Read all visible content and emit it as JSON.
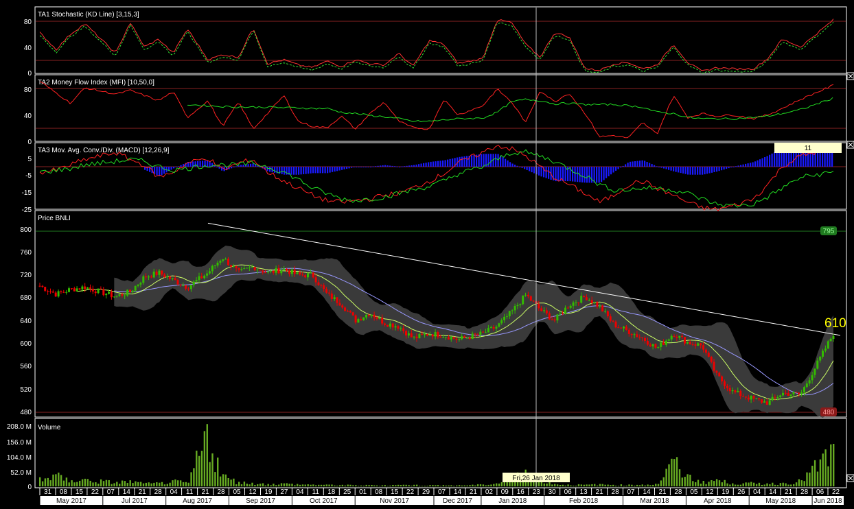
{
  "panels": {
    "stoch": {
      "title": "TA1 Stochastic (KD Line) [3,15,3]",
      "ticks": [
        "80",
        "40",
        "0"
      ]
    },
    "mfi": {
      "title": "TA2 Money Flow Index (MFI) [10,50,0]",
      "ticks": [
        "80",
        "40",
        "0"
      ]
    },
    "macd": {
      "title": "TA3 Mov. Avg. Conv./Div. (MACD) [12,26,9]",
      "ticks": [
        "5",
        "-5",
        "-15",
        "-25"
      ],
      "value_box": "11"
    },
    "price": {
      "title": "Price BNLI",
      "ticks": [
        "800",
        "760",
        "720",
        "680",
        "640",
        "600",
        "560",
        "520",
        "480"
      ],
      "high_tag": "795",
      "low_tag": "480",
      "last_price": "610"
    },
    "volume": {
      "title": "Volume",
      "ticks": [
        "208.0 M",
        "156.0 M",
        "104.0 M",
        "52.0 M",
        "0"
      ]
    }
  },
  "crosshair": {
    "date": "Fri,26 Jan 2018"
  },
  "x_axis": {
    "dates": [
      "31",
      "08",
      "15",
      "22",
      "07",
      "14",
      "21",
      "28",
      "04",
      "11",
      "21",
      "28",
      "05",
      "12",
      "19",
      "27",
      "04",
      "11",
      "18",
      "25",
      "01",
      "08",
      "15",
      "22",
      "29",
      "07",
      "14",
      "21",
      "02",
      "09",
      "16",
      "23",
      "30",
      "06",
      "13",
      "21",
      "28",
      "07",
      "14",
      "21",
      "28",
      "05",
      "12",
      "19",
      "26",
      "04",
      "14",
      "21",
      "28",
      "06",
      "22"
    ],
    "months": [
      "May 2017",
      "Jul 2017",
      "Aug 2017",
      "Sep 2017",
      "Oct 2017",
      "Nov 2017",
      "Dec 2017",
      "Jan 2018",
      "Feb 2018",
      "Mar 2018",
      "Apr 2018",
      "May 2018",
      "Jun 2018"
    ]
  },
  "colors": {
    "up": "#33bb00",
    "down": "#ee0000",
    "ma_short": "#ccff66",
    "ma_long": "#9999ff",
    "band": "#444444",
    "grid": "#882222",
    "volume": "#66aa22",
    "macd_hist": "#1a1aff",
    "macd_line": "#ff2222",
    "signal_line": "#22dd22",
    "trendline": "#ffffff",
    "last_price": "#ffff00",
    "high_tag": "#1f7a1f",
    "low_tag": "#8b1a1a"
  },
  "chart_data": {
    "type": "candlestick",
    "symbol": "BNLI",
    "price_ylim": [
      470,
      815
    ],
    "price_series": [
      [
        "2017-05-31",
        690
      ],
      [
        "2017-06-08",
        676
      ],
      [
        "2017-06-15",
        684
      ],
      [
        "2017-06-22",
        688
      ],
      [
        "2017-07-07",
        672
      ],
      [
        "2017-07-14",
        680
      ],
      [
        "2017-07-21",
        705
      ],
      [
        "2017-07-28",
        712
      ],
      [
        "2017-08-04",
        700
      ],
      [
        "2017-08-11",
        688
      ],
      [
        "2017-08-21",
        712
      ],
      [
        "2017-08-28",
        738
      ],
      [
        "2017-09-05",
        712
      ],
      [
        "2017-09-12",
        722
      ],
      [
        "2017-09-19",
        712
      ],
      [
        "2017-09-27",
        718
      ],
      [
        "2017-10-04",
        708
      ],
      [
        "2017-10-11",
        708
      ],
      [
        "2017-10-18",
        676
      ],
      [
        "2017-10-25",
        660
      ],
      [
        "2017-11-01",
        632
      ],
      [
        "2017-11-08",
        645
      ],
      [
        "2017-11-15",
        628
      ],
      [
        "2017-11-22",
        622
      ],
      [
        "2017-11-29",
        602
      ],
      [
        "2017-12-07",
        610
      ],
      [
        "2017-12-14",
        607
      ],
      [
        "2017-12-21",
        600
      ],
      [
        "2018-01-02",
        610
      ],
      [
        "2018-01-09",
        622
      ],
      [
        "2018-01-16",
        646
      ],
      [
        "2018-01-23",
        675
      ],
      [
        "2018-01-30",
        650
      ],
      [
        "2018-02-06",
        632
      ],
      [
        "2018-02-13",
        658
      ],
      [
        "2018-02-21",
        672
      ],
      [
        "2018-02-28",
        655
      ],
      [
        "2018-03-07",
        625
      ],
      [
        "2018-03-14",
        614
      ],
      [
        "2018-03-21",
        602
      ],
      [
        "2018-03-28",
        585
      ],
      [
        "2018-04-05",
        610
      ],
      [
        "2018-04-12",
        595
      ],
      [
        "2018-04-19",
        590
      ],
      [
        "2018-04-26",
        540
      ],
      [
        "2018-05-04",
        512
      ],
      [
        "2018-05-14",
        500
      ],
      [
        "2018-05-21",
        494
      ],
      [
        "2018-05-28",
        510
      ],
      [
        "2018-06-06",
        508
      ],
      [
        "2018-06-22",
        610
      ]
    ],
    "stoch_series": [
      62,
      36,
      60,
      76,
      30,
      78,
      40,
      52,
      30,
      68,
      20,
      28,
      24,
      70,
      14,
      20,
      12,
      8,
      18,
      10,
      20,
      14,
      12,
      30,
      10,
      50,
      44,
      14,
      22,
      82,
      78,
      44,
      24,
      62,
      56,
      6,
      4,
      14,
      16,
      6,
      12,
      44,
      16,
      2,
      8,
      6,
      6,
      22,
      52,
      40,
      82
    ],
    "mfi_series": [
      92,
      74,
      58,
      82,
      72,
      78,
      70,
      62,
      76,
      36,
      62,
      22,
      60,
      18,
      42,
      70,
      30,
      22,
      20,
      38,
      18,
      42,
      60,
      30,
      20,
      18,
      64,
      40,
      54,
      80,
      60,
      28,
      78,
      60,
      74,
      42,
      6,
      8,
      4,
      28,
      10,
      70,
      36,
      42,
      38,
      40,
      34,
      40,
      50,
      64,
      86
    ],
    "mfi_signal": [
      null,
      null,
      null,
      null,
      null,
      null,
      null,
      null,
      null,
      56,
      54,
      53,
      52,
      52,
      52,
      51,
      51,
      50,
      50,
      44,
      42,
      39,
      37,
      34,
      30,
      30,
      32,
      34,
      35,
      44,
      60,
      64,
      62,
      57,
      58,
      56,
      56,
      56,
      54,
      52,
      44,
      42,
      36,
      34,
      34,
      34,
      36,
      38,
      42,
      48,
      66
    ],
    "macd_series": [
      -3,
      -2,
      1,
      4,
      8,
      4,
      1,
      -6,
      -3,
      2,
      5,
      -2,
      2,
      4,
      -3,
      -8,
      -12,
      -16,
      -19,
      -20,
      -19,
      -18,
      -16,
      -15,
      -12,
      -8,
      -4,
      2,
      8,
      12,
      10,
      6,
      0,
      -6,
      -10,
      -15,
      -20,
      -16,
      -10,
      -8,
      -12,
      -16,
      -20,
      -23,
      -24,
      -22,
      -18,
      -10,
      0,
      6,
      11
    ],
    "macd_signal": [
      -3,
      -2,
      -1,
      1,
      3,
      4,
      3,
      0,
      -2,
      -1,
      1,
      1,
      1,
      2,
      0,
      -3,
      -7,
      -12,
      -15,
      -18,
      -19,
      -18,
      -17,
      -15,
      -13,
      -11,
      -8,
      -4,
      0,
      4,
      8,
      8,
      6,
      3,
      -1,
      -5,
      -10,
      -13,
      -13,
      -12,
      -12,
      -13,
      -15,
      -18,
      -21,
      -22,
      -21,
      -17,
      -12,
      -6,
      -3
    ],
    "volume_series": [
      30,
      40,
      20,
      25,
      15,
      20,
      10,
      12,
      20,
      12,
      205,
      40,
      15,
      12,
      8,
      10,
      8,
      6,
      6,
      5,
      4,
      4,
      4,
      5,
      5,
      4,
      4,
      4,
      6,
      10,
      30,
      55,
      30,
      8,
      6,
      6,
      8,
      5,
      6,
      6,
      8,
      90,
      40,
      18,
      24,
      10,
      12,
      10,
      12,
      20,
      140
    ],
    "volume_ylim": [
      0,
      210
    ],
    "trendline": [
      [
        "2017-08-21",
        795
      ],
      [
        "2018-06-22",
        607
      ]
    ],
    "resistance": 795,
    "support": 480
  }
}
